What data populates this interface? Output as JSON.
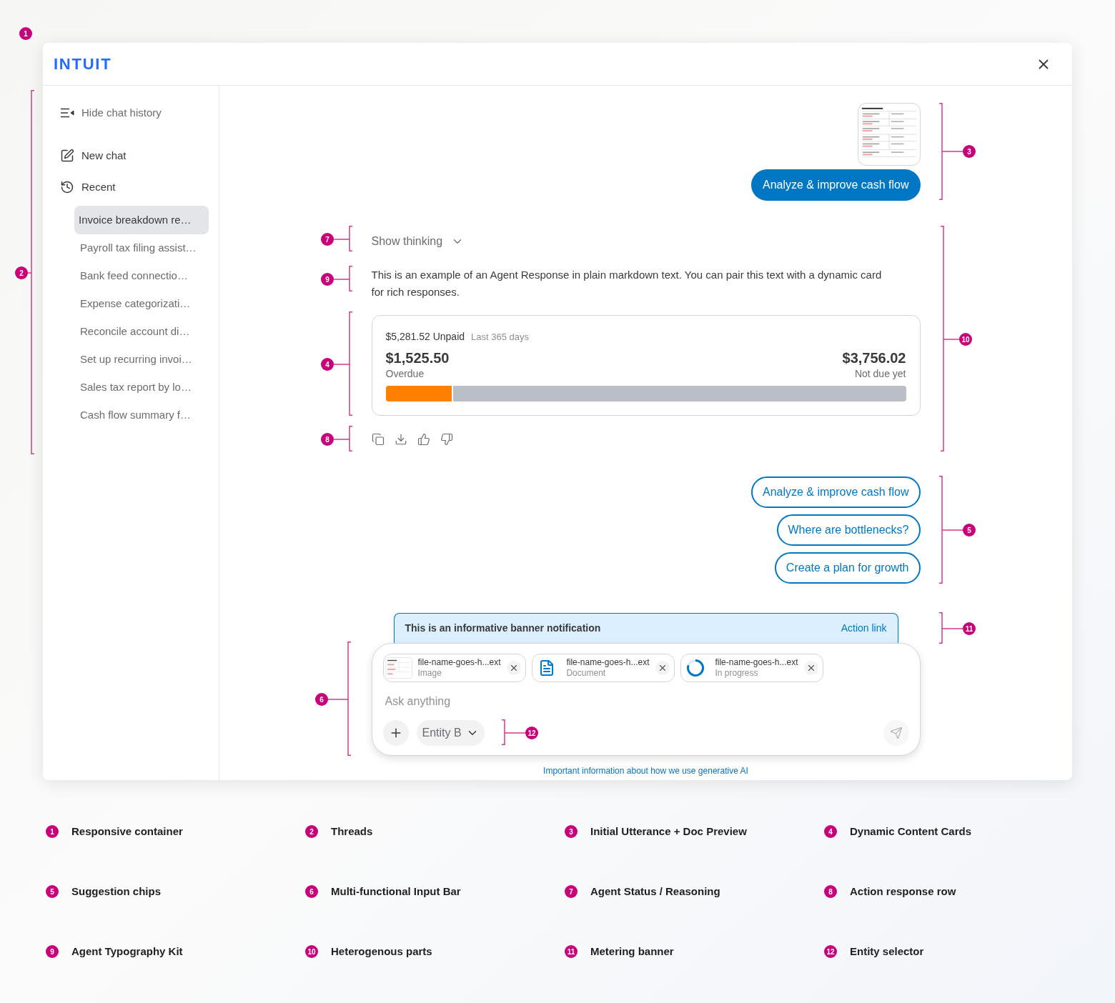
{
  "window": {
    "logo": "INTUIT"
  },
  "sidebar": {
    "hide_history": "Hide chat history",
    "new_chat": "New chat",
    "recent": "Recent",
    "threads": [
      {
        "title": "Invoice breakdown re…",
        "selected": true
      },
      {
        "title": "Payroll tax filing assist…",
        "selected": false
      },
      {
        "title": "Bank feed connectio…",
        "selected": false
      },
      {
        "title": "Expense categorizati…",
        "selected": false
      },
      {
        "title": "Reconcile account di…",
        "selected": false
      },
      {
        "title": "Set up recurring invoi…",
        "selected": false
      },
      {
        "title": "Sales tax report by lo…",
        "selected": false
      },
      {
        "title": "Cash flow summary f…",
        "selected": false
      }
    ]
  },
  "conversation": {
    "user_message": "Analyze & improve cash flow",
    "show_thinking": "Show thinking",
    "agent_text": "This is an example of an Agent Response in plain markdown text. You can pair this text with a dynamic card for rich responses.",
    "card": {
      "total": "$5,281.52 Unpaid",
      "period": "Last 365 days",
      "overdue_amount": "$1,525.50",
      "overdue_label": "Overdue",
      "upcoming_amount": "$3,756.02",
      "upcoming_label": "Not due yet",
      "level": 0.13
    },
    "suggestions": [
      "Analyze & improve cash flow",
      "Where are bottlenecks?",
      "Create a plan for growth"
    ]
  },
  "banner": {
    "message": "This is an informative banner notification",
    "action": "Action link"
  },
  "input_bar": {
    "attachments": [
      {
        "kind": "image",
        "name": "file-name-goes-h...ext",
        "status": "Image"
      },
      {
        "kind": "document",
        "name": "file-name-goes-h...ext",
        "status": "Document"
      },
      {
        "kind": "progress",
        "name": "file-name-goes-h...ext",
        "status": "In progress"
      }
    ],
    "placeholder": "Ask anything",
    "entity": "Entity B"
  },
  "footer_link": "Important information about how we use generative AI",
  "annotation_markers": [
    "1",
    "3",
    "7",
    "2",
    "9",
    "10",
    "4",
    "8",
    "5",
    "11",
    "6",
    "12"
  ],
  "legend": [
    {
      "number": "1",
      "label": "Responsive container"
    },
    {
      "number": "2",
      "label": "Threads"
    },
    {
      "number": "3",
      "label": "Initial Utterance + Doc Preview"
    },
    {
      "number": "4",
      "label": "Dynamic Content Cards"
    },
    {
      "number": "5",
      "label": "Suggestion chips"
    },
    {
      "number": "6",
      "label": "Multi-functional Input Bar"
    },
    {
      "number": "7",
      "label": "Agent Status / Reasoning"
    },
    {
      "number": "8",
      "label": "Action response row"
    },
    {
      "number": "9",
      "label": "Agent Typography Kit"
    },
    {
      "number": "10",
      "label": "Heterogenous parts"
    },
    {
      "number": "11",
      "label": "Metering banner"
    },
    {
      "number": "12",
      "label": "Entity selector"
    }
  ]
}
